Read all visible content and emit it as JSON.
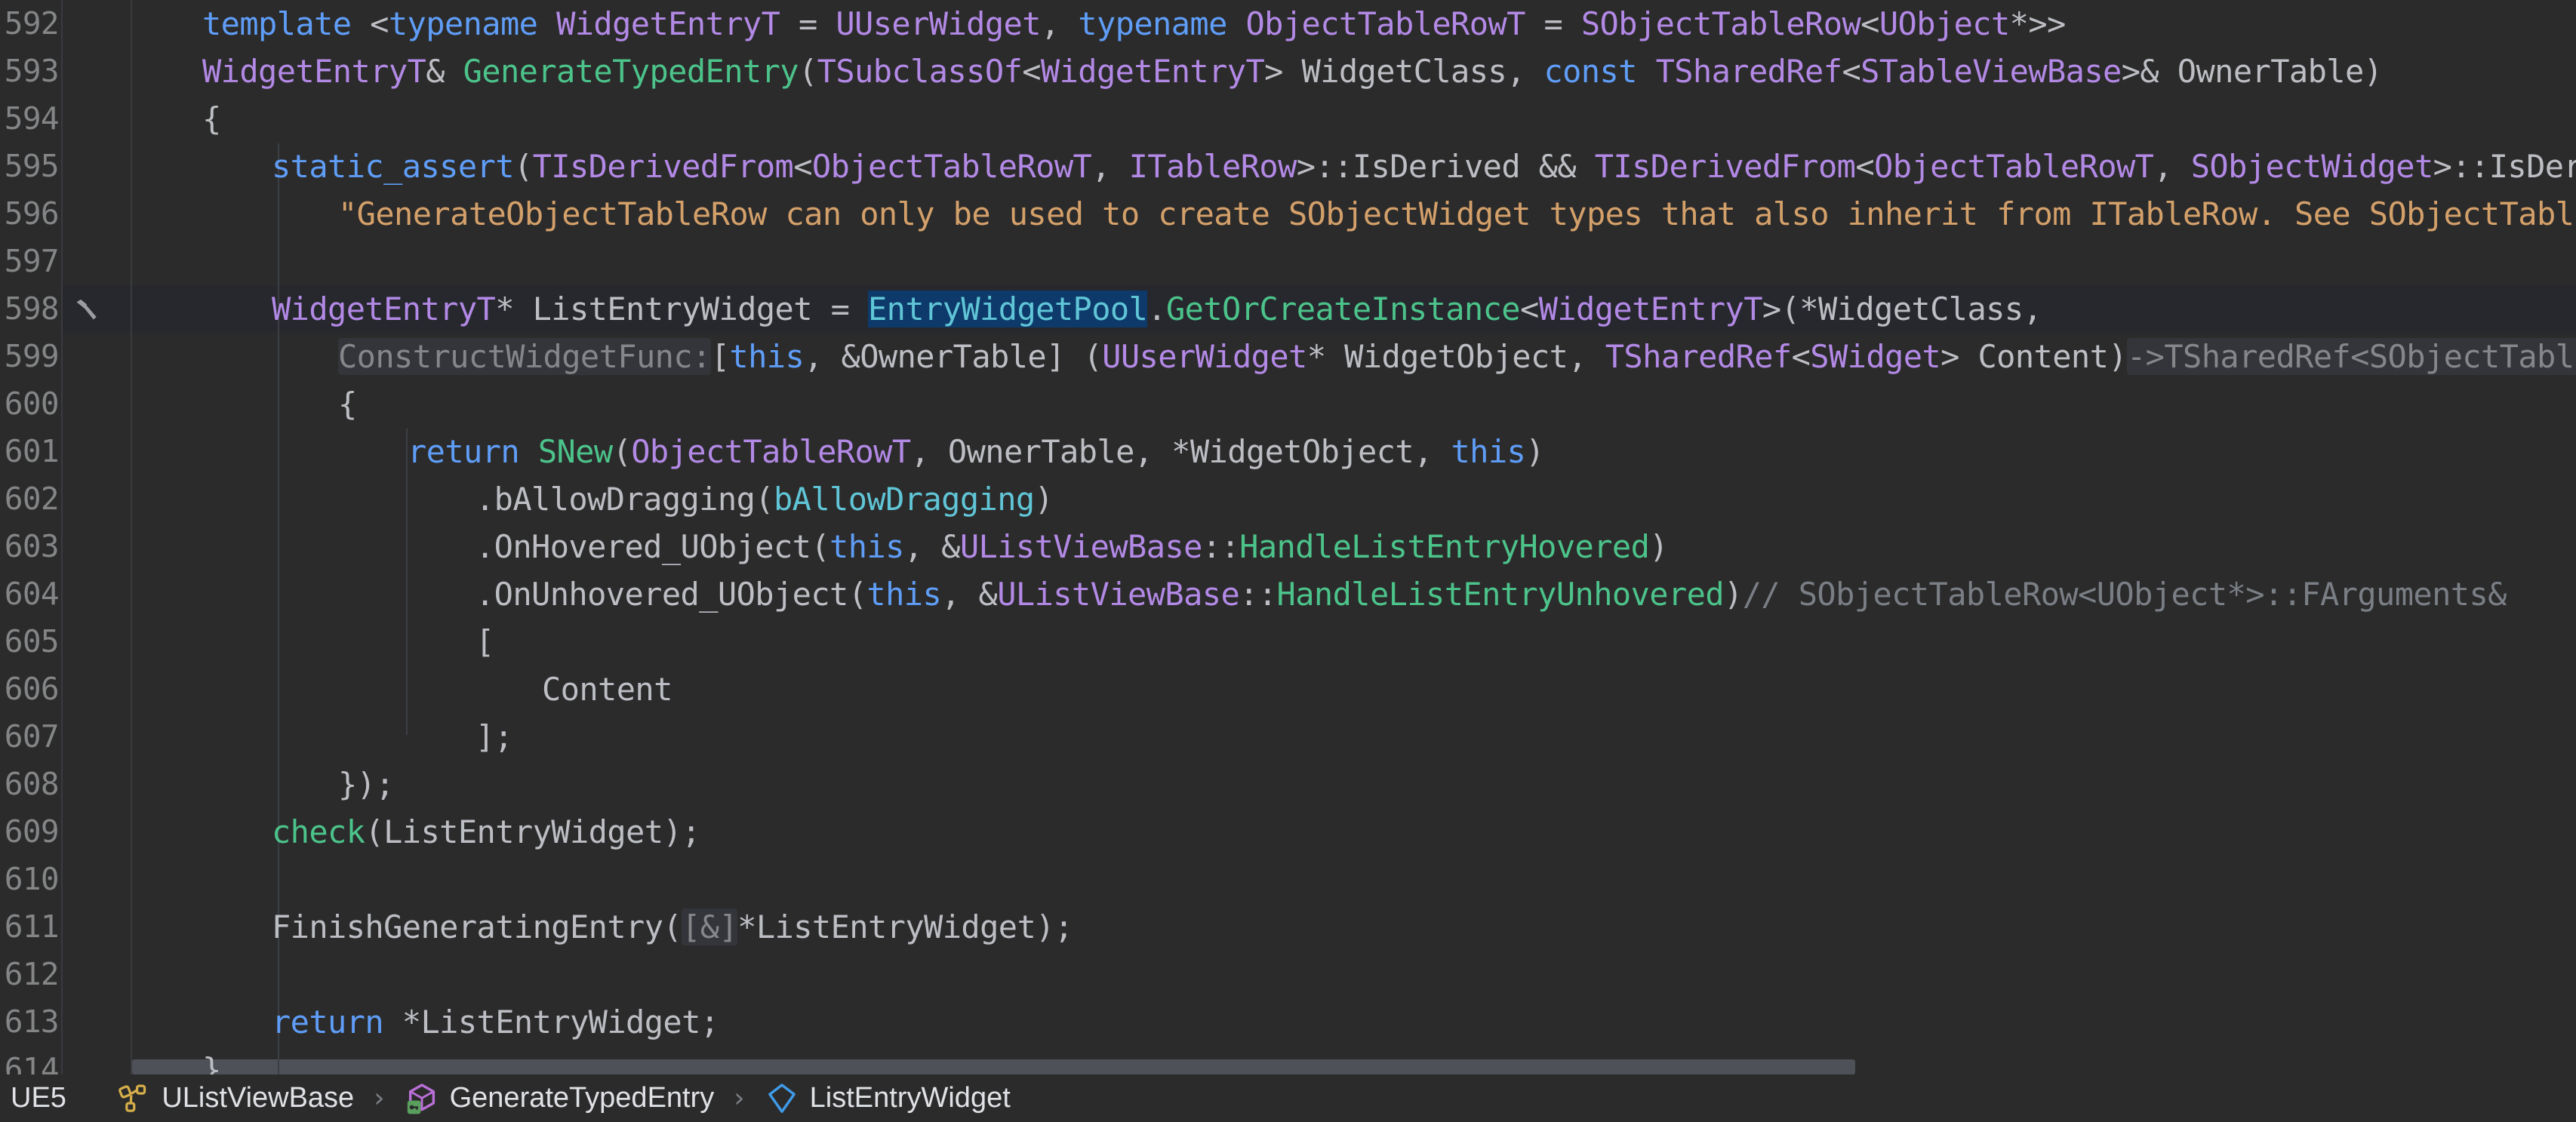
{
  "window": {
    "background": "#2b2b2b",
    "gutter_background": "#2b2b2b",
    "current_line_background": "#26282e",
    "selection_background": "#0d3a6b"
  },
  "editor": {
    "first_line_number": 592,
    "language": "cpp",
    "gutter_marker": {
      "line": 598,
      "icon": "hammer-icon",
      "tooltip": ""
    },
    "selection": {
      "line": 598,
      "text": "EntryWidgetPool"
    },
    "lines": [
      {
        "number": "592",
        "indent": 0,
        "text": "template <typename WidgetEntryT = UUserWidget, typename ObjectTableRowT = SObjectTableRow<UObject*>>"
      },
      {
        "number": "593",
        "indent": 0,
        "text": "WidgetEntryT& GenerateTypedEntry(TSubclassOf<WidgetEntryT> WidgetClass, const TSharedRef<STableViewBase>& OwnerTable)"
      },
      {
        "number": "594",
        "indent": 0,
        "text": "{"
      },
      {
        "number": "595",
        "indent": 1,
        "text": "static_assert(TIsDerivedFrom<ObjectTableRowT, ITableRow>::IsDerived && TIsDerivedFrom<ObjectTableRowT, SObjectWidget>::IsDerived,"
      },
      {
        "number": "596",
        "indent": 1,
        "text": "    \"GenerateObjectTableRow can only be used to create SObjectWidget types that also inherit from ITableRow. See SObjectTableRow.\");"
      },
      {
        "number": "597",
        "indent": 1,
        "text": ""
      },
      {
        "number": "598",
        "indent": 1,
        "text": "WidgetEntryT* ListEntryWidget = EntryWidgetPool.GetOrCreateInstance<WidgetEntryT>(*WidgetClass,"
      },
      {
        "number": "599",
        "indent": 1,
        "text": "    ConstructWidgetFunc:[this, &OwnerTable] (UUserWidget* WidgetObject, TSharedRef<SWidget> Content)->TSharedRef<SObjectTableRow<UObject*>>"
      },
      {
        "number": "600",
        "indent": 1,
        "text": "    {"
      },
      {
        "number": "601",
        "indent": 2,
        "text": "    return SNew(ObjectTableRowT, OwnerTable, *WidgetObject, this)"
      },
      {
        "number": "602",
        "indent": 3,
        "text": "        .bAllowDragging(bAllowDragging)"
      },
      {
        "number": "603",
        "indent": 3,
        "text": "        .OnHovered_UObject(this, &UListViewBase::HandleListEntryHovered)"
      },
      {
        "number": "604",
        "indent": 3,
        "text": "        .OnUnhovered_UObject(this, &UListViewBase::HandleListEntryUnhovered)// SObjectTableRow<UObject*>::FArguments&"
      },
      {
        "number": "605",
        "indent": 3,
        "text": "        ["
      },
      {
        "number": "606",
        "indent": 4,
        "text": "            Content"
      },
      {
        "number": "607",
        "indent": 3,
        "text": "        ];"
      },
      {
        "number": "608",
        "indent": 1,
        "text": "    });"
      },
      {
        "number": "609",
        "indent": 1,
        "text": "check(ListEntryWidget);"
      },
      {
        "number": "610",
        "indent": 1,
        "text": ""
      },
      {
        "number": "611",
        "indent": 1,
        "text": "FinishGeneratingEntry([&]*ListEntryWidget);"
      },
      {
        "number": "612",
        "indent": 1,
        "text": ""
      },
      {
        "number": "613",
        "indent": 1,
        "text": "return *ListEntryWidget;"
      },
      {
        "number": "614",
        "indent": 0,
        "text": "}"
      }
    ],
    "inlay_hints": [
      {
        "line": "599",
        "text": "ConstructWidgetFunc:"
      },
      {
        "line": "599",
        "text": "->TSharedRef<SObjectTableRow<UObject*>>"
      },
      {
        "line": "611",
        "text": "[&]"
      }
    ],
    "comments": [
      {
        "line": "604",
        "text": "// SObjectTableRow<UObject*>::FArguments&"
      }
    ]
  },
  "scrollbar": {
    "orientation": "horizontal",
    "thumb_fraction": 0.705
  },
  "breadcrumb": {
    "items": [
      {
        "label": "UE5",
        "icon": null
      },
      {
        "label": "UListViewBase",
        "icon": "class-icon"
      },
      {
        "label": "GenerateTypedEntry",
        "icon": "method-protected-icon"
      },
      {
        "label": "ListEntryWidget",
        "icon": "variable-icon"
      }
    ],
    "separator": "›"
  }
}
